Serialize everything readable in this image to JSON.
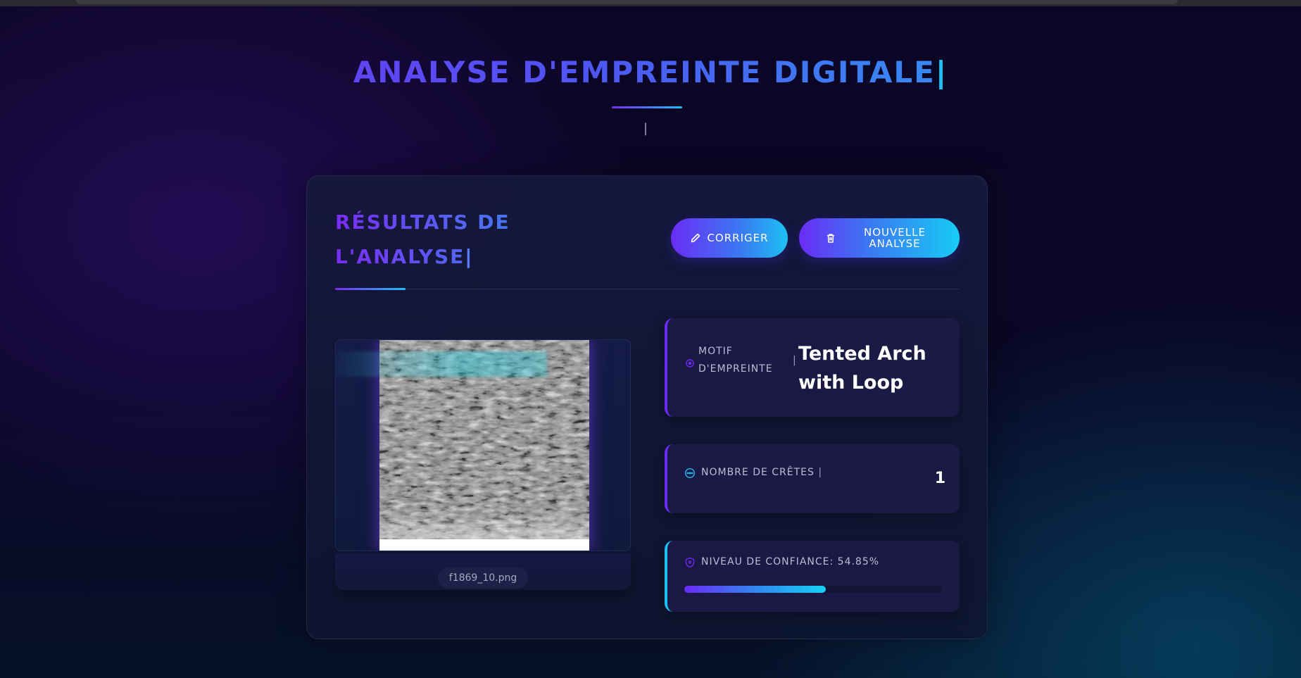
{
  "header": {
    "title": "ANALYSE D'EMPREINTE DIGITALE",
    "title_cursor": "|",
    "subtitle": "|"
  },
  "results": {
    "title": "RÉSULTATS DE L'ANALYSE",
    "title_cursor": "|",
    "buttons": {
      "correct_label": "CORRIGER",
      "new_analysis_label": "NOUVELLE ANALYSE"
    },
    "image": {
      "filename": "f1869_10.png"
    },
    "pattern": {
      "label": "MOTIF D'EMPREINTE",
      "cursor": "|",
      "value": "Tented Arch with Loop"
    },
    "ridges": {
      "label": "NOMBRE DE CRÊTES",
      "cursor": "|",
      "value": "1"
    },
    "confidence": {
      "label": "NIVEAU DE CONFIANCE: 54.85%",
      "value_percent": 54.85
    }
  },
  "colors": {
    "accent_purple": "#6a2cf5",
    "accent_cyan": "#1ec0f2",
    "background": "#0a0520"
  },
  "icons": {
    "correct": "pencil-icon",
    "new_analysis": "trash-icon",
    "pattern": "target-icon",
    "ridges": "dots-circle-icon",
    "confidence": "shield-icon"
  }
}
